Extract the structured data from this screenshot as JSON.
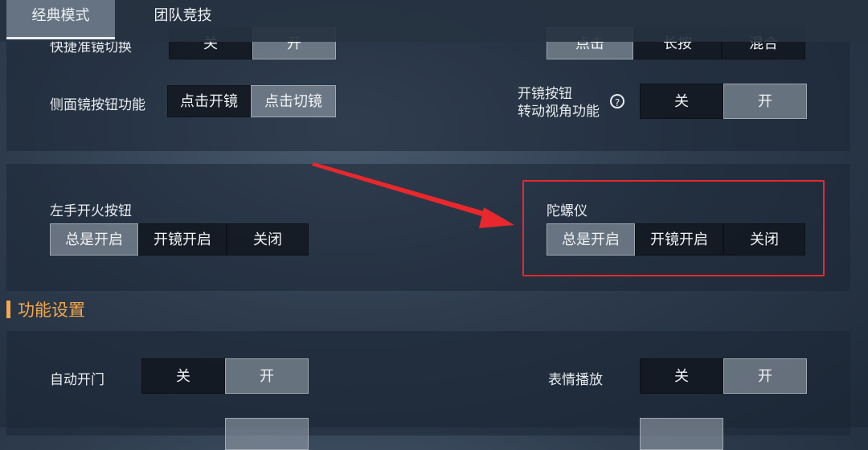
{
  "tabs": [
    {
      "label": "经典模式"
    },
    {
      "label": "团队竞技"
    }
  ],
  "section1": {
    "row0": {
      "label": "快捷准镜切换",
      "options": [
        "关",
        "开"
      ],
      "right_options": [
        "点击",
        "长按",
        "混合"
      ]
    },
    "side_scope": {
      "label": "侧面镜按钮功能",
      "options": [
        "点击开镜",
        "点击切镜"
      ]
    },
    "scope_rotate": {
      "label_line1": "开镜按钮",
      "label_line2": "转动视角功能",
      "help": "?",
      "options": [
        "关",
        "开"
      ]
    }
  },
  "section2": {
    "left_fire": {
      "label": "左手开火按钮",
      "options": [
        "总是开启",
        "开镜开启",
        "关闭"
      ]
    },
    "gyro": {
      "label": "陀螺仪",
      "options": [
        "总是开启",
        "开镜开启",
        "关闭"
      ]
    }
  },
  "section3": {
    "title": "功能设置",
    "auto_door": {
      "label": "自动开门",
      "options": [
        "关",
        "开"
      ]
    },
    "emote": {
      "label": "表情播放",
      "options": [
        "关",
        "开"
      ]
    }
  },
  "colors": {
    "accent": "#f5a84a",
    "highlight": "#e8282c"
  },
  "icons": {
    "help": "help-icon",
    "arrow": "red-arrow"
  }
}
